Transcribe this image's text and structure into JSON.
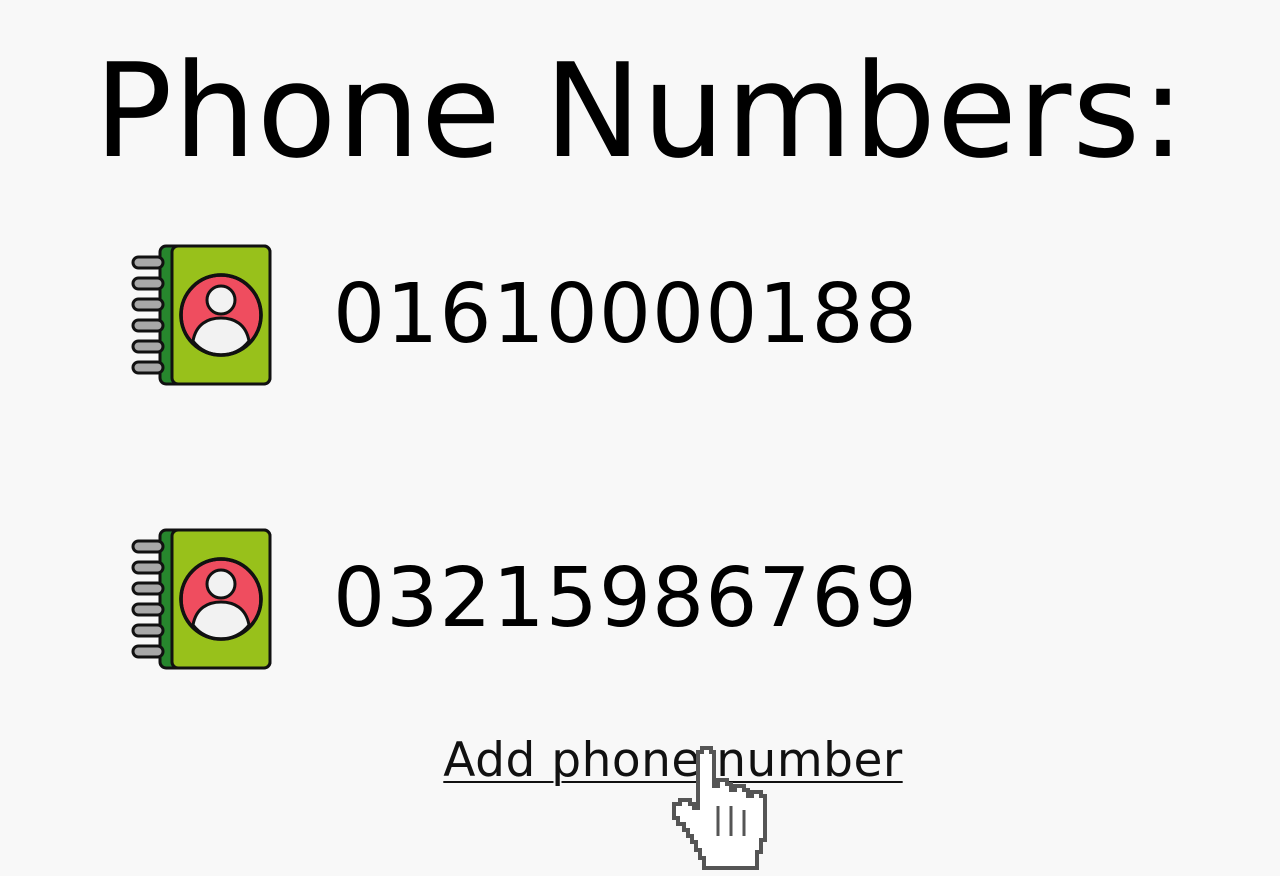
{
  "header": {
    "title": "Phone Numbers:"
  },
  "phone_list": [
    {
      "number": "01610000188",
      "icon": "contact-book-icon"
    },
    {
      "number": "03215986769",
      "icon": "contact-book-icon"
    }
  ],
  "actions": {
    "add_label": "Add phone number"
  },
  "cursor": {
    "icon": "hand-pointer-cursor-icon"
  },
  "colors": {
    "background": "#f8f8f8",
    "book_cover": "#98c11b",
    "book_spine": "#27862d",
    "avatar_circle": "#ef4d5f",
    "spiral_rings": "#a8a8a8",
    "text": "#000000"
  }
}
